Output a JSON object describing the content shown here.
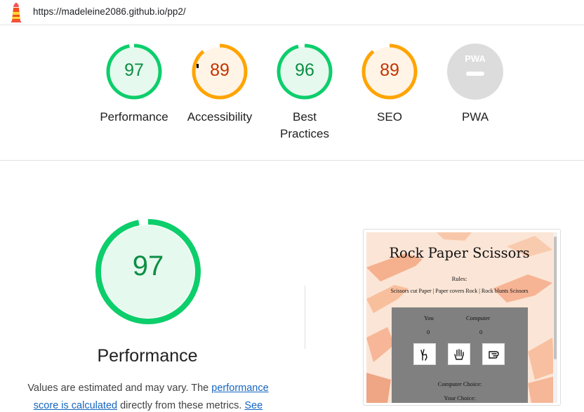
{
  "header": {
    "url": "https://madeleine2086.github.io/pp2/",
    "logo_icon": "lighthouse-icon"
  },
  "categories": [
    {
      "label": "Performance",
      "score": "97",
      "rating": "pass",
      "color": "#0c8e44",
      "ring": "#0cce6b",
      "fill": "#e6f9ee"
    },
    {
      "label": "Accessibility",
      "score": "89",
      "rating": "average",
      "color": "#c33300",
      "ring": "#ffa400",
      "fill": "#fff4e6"
    },
    {
      "label_line1": "Best",
      "label_line2": "Practices",
      "score": "96",
      "rating": "pass",
      "color": "#0c8e44",
      "ring": "#0cce6b",
      "fill": "#e6f9ee"
    },
    {
      "label": "SEO",
      "score": "89",
      "rating": "average",
      "color": "#c33300",
      "ring": "#ffa400",
      "fill": "#fff4e6"
    },
    {
      "label": "PWA",
      "badge_text": "PWA",
      "rating": "na"
    }
  ],
  "performance": {
    "score": "97",
    "title": "Performance",
    "desc_text1": "Values are estimated and may vary. The ",
    "link1": "performance",
    "link1b": "score is calculated",
    "desc_text2": " directly from these metrics. ",
    "link2": "See"
  },
  "screenshot": {
    "title": "Rock Paper Scissors",
    "rules_label": "Rules:",
    "rules_text": "Scissors cut Paper | Paper covers Rock | Rock blunts Scissors",
    "you_label": "You",
    "computer_label": "Computer",
    "you_score": "0",
    "computer_score": "0",
    "buttons": [
      "scissors-hand-icon",
      "paper-hand-icon",
      "rock-hand-icon"
    ],
    "computer_choice_label": "Computer Choice:",
    "your_choice_label": "Your Choice:"
  }
}
